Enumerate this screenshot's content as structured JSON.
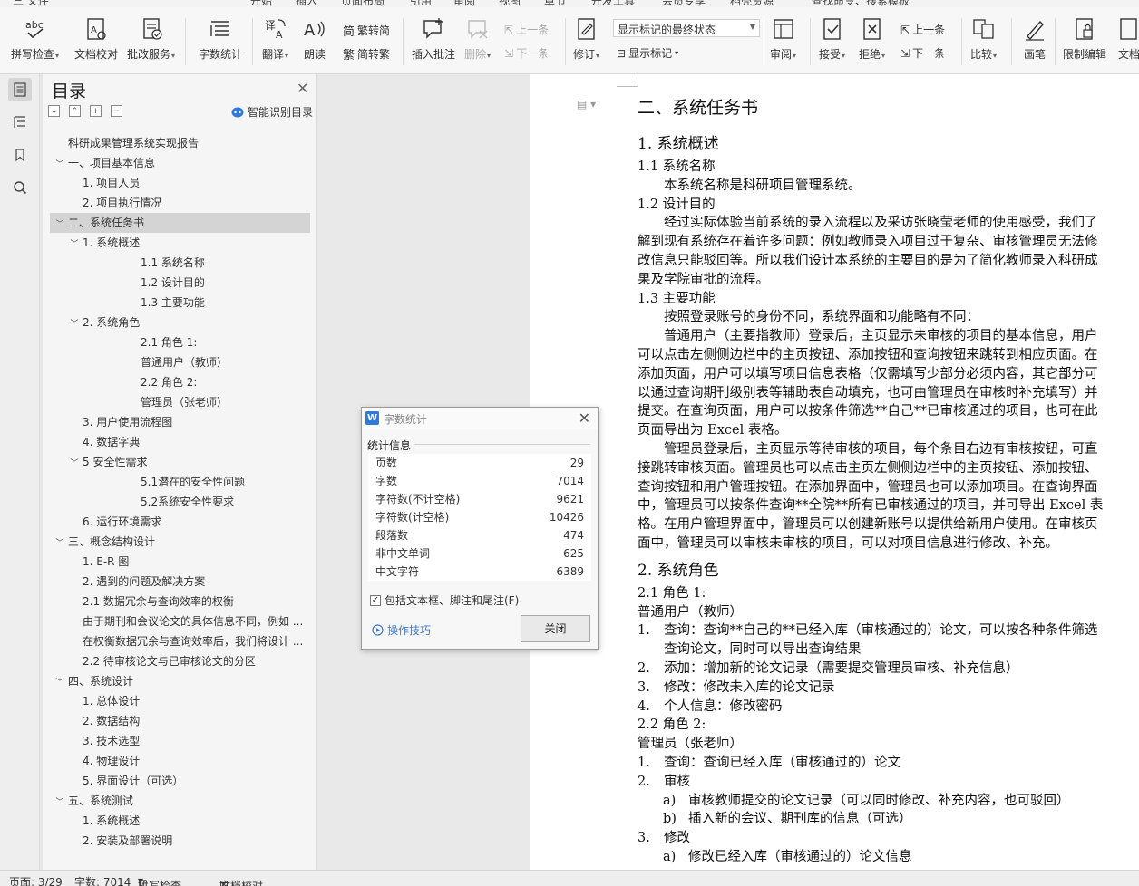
{
  "menu": {
    "items": [
      "三 文件",
      "开始",
      "插入",
      "页面布局",
      "引用",
      "审阅",
      "视图",
      "章节",
      "开发工具",
      "会员专享",
      "稻壳资源",
      "查找命令、搜索模板"
    ]
  },
  "ribbon": {
    "spell_check": "拼写检查",
    "doc_proof": "文档校对",
    "annotate_service": "批改服务",
    "word_count": "字数统计",
    "translate": "翻译",
    "read_aloud": "朗读",
    "trad_chinese": "繁转简",
    "simp_chinese": "简转繁",
    "insert_comment": "插入批注",
    "delete": "删除",
    "prev_comment": "上一条",
    "next_comment": "下一条",
    "track_changes": "修订",
    "markup_select": "显示标记的最终状态",
    "show_markup": "显示标记",
    "review": "审阅",
    "accept": "接受",
    "reject": "拒绝",
    "prev_change": "上一条",
    "next_change": "下一条",
    "compare": "比较",
    "ink": "画笔",
    "restrict_edit": "限制编辑",
    "doc_rights": "文档"
  },
  "toc": {
    "title": "目录",
    "smart_detect": "智能识别目录",
    "items": [
      "科研成果管理系统实现报告",
      "一、项目基本信息",
      "1. 项目人员",
      "2. 项目执行情况",
      "二、系统任务书",
      "1. 系统概述",
      "1.1  系统名称",
      "1.2  设计目的",
      "1.3  主要功能",
      "2. 系统角色",
      "2.1  角色 1:",
      "普通用户（教师）",
      "2.2  角色 2:",
      "管理员（张老师）",
      "3. 用户使用流程图",
      "4. 数据字典",
      "5  安全性需求",
      "5.1潜在的安全性问题",
      "5.2系统安全性要求",
      "6. 运行环境需求",
      "三、概念结构设计",
      "1. E-R 图",
      "2. 遇到的问题及解决方案",
      "2.1  数据冗余与查询效率的权衡",
      "由于期刊和会议论文的具体信息不同，例如 ...",
      "在权衡数据冗余与查询效率后，我们将设计 ...",
      "2.2  待审核论文与已审核论文的分区",
      "四、系统设计",
      "1. 总体设计",
      "2. 数据结构",
      "3. 技术选型",
      "4. 物理设计",
      "5. 界面设计（可选）",
      "五、系统测试",
      "1. 系统概述",
      "2. 安装及部署说明"
    ]
  },
  "dialog": {
    "title": "字数统计",
    "section": "统计信息",
    "rows": [
      {
        "label": "页数",
        "value": "29"
      },
      {
        "label": "字数",
        "value": "7014"
      },
      {
        "label": "字符数(不计空格)",
        "value": "9621"
      },
      {
        "label": "字符数(计空格)",
        "value": "10426"
      },
      {
        "label": "段落数",
        "value": "474"
      },
      {
        "label": "非中文单词",
        "value": "625"
      },
      {
        "label": "中文字符",
        "value": "6389"
      }
    ],
    "include_label": "包括文本框、脚注和尾注(F)",
    "tips": "操作技巧",
    "close": "关闭"
  },
  "doc": {
    "h_task": "二、系统任务书",
    "h_overview": "1.  系统概述",
    "s_name": "1.1  系统名称",
    "p_name": "本系统名称是科研项目管理系统。",
    "s_purpose": "1.2  设计目的",
    "p_purpose_1": "经过实际体验当前系统的录入流程以及采访张晓莹老师的使用感受，我们了",
    "p_purpose_2": "解到现有系统存在着许多问题：例如教师录入项目过于复杂、审核管理员无法修",
    "p_purpose_3": "改信息只能驳回等。所以我们设计本系统的主要目的是为了简化教师录入科研成",
    "p_purpose_4": "果及学院审批的流程。",
    "s_func": "1.3  主要功能",
    "p_func_0": "按照登录账号的身份不同，系统界面和功能略有不同：",
    "p_func_1": "普通用户（主要指教师）登录后，主页显示未审核的项目的基本信息，用户",
    "p_func_2": "可以点击左侧侧边栏中的主页按钮、添加按钮和查询按钮来跳转到相应页面。在",
    "p_func_3": "添加页面，用户可以填写项目信息表格（仅需填写少部分必须内容，其它部分可",
    "p_func_4": "以通过查询期刊级别表等辅助表自动填充，也可由管理员在审核时补充填写）并",
    "p_func_5": "提交。在查询页面，用户可以按条件筛选**自己**已审核通过的项目，也可在此",
    "p_func_6": "页面导出为  Excel  表格。",
    "p_admin_1": "管理员登录后，主页显示等待审核的项目，每个条目右边有审核按钮，可直",
    "p_admin_2": "接跳转审核页面。管理员也可以点击主页左侧侧边栏中的主页按钮、添加按钮、",
    "p_admin_3": "查询按钮和用户管理按钮。在添加界面中，管理员也可以添加项目。在查询界面",
    "p_admin_4": "中，管理员可以按条件查询**全院**所有已审核通过的项目，并可导出  Excel  表",
    "p_admin_5": "格。在用户管理界面中，管理员可以创建新账号以提供给新用户使用。在审核页",
    "p_admin_6": "面中，管理员可以审核未审核的项目，可以对项目信息进行修改、补充。",
    "h_roles": "2.  系统角色",
    "s_role1": "2.1  角色 1:",
    "p_role1": "普通用户（教师）",
    "r1_1n": "1.",
    "r1_1a": "查询：查询**自己的**已经入库（审核通过的）论文，可以按各种条件筛选",
    "r1_1b": "查询论文，同时可以导出查询结果",
    "r1_2n": "2.",
    "r1_2": "添加：增加新的论文记录（需要提交管理员审核、补充信息）",
    "r1_3n": "3.",
    "r1_3": "修改：修改未入库的论文记录",
    "r1_4n": "4.",
    "r1_4": "个人信息：修改密码",
    "s_role2": "2.2  角色 2:",
    "p_role2": "管理员（张老师）",
    "r2_1n": "1.",
    "r2_1": "查询：查询已经入库（审核通过的）论文",
    "r2_2n": "2.",
    "r2_2": "审核",
    "r2_2an": "a)",
    "r2_2a": "审核教师提交的论文记录（可以同时修改、补充内容，也可驳回）",
    "r2_2bn": "b)",
    "r2_2b": "插入新的会议、期刊库的信息（可选）",
    "r2_3n": "3.",
    "r2_3": "修改",
    "r2_3an": "a)",
    "r2_3a": "修改已经入库（审核通过的）论文信息"
  },
  "status": {
    "page": "页面: 3/29",
    "words": "字数: 7014",
    "spell": "拼写检查",
    "proof": "文档校对"
  },
  "colors": {
    "accent": "#2f7ad9",
    "link": "#3a7bd5"
  }
}
